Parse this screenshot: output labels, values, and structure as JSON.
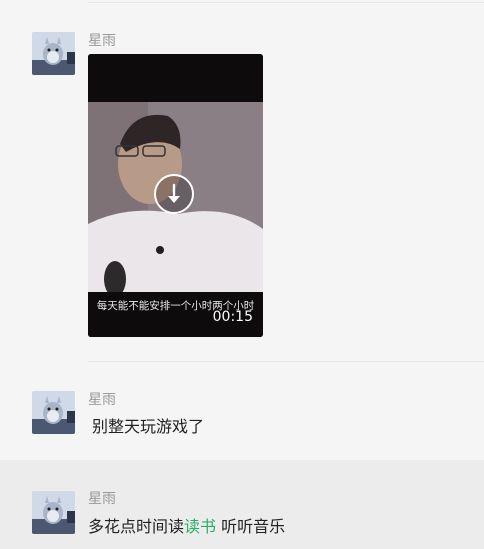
{
  "messages": [
    {
      "sender": "星雨",
      "type": "video",
      "subtitle": "每天能不能安排一个小时两个小时",
      "duration": "00:15"
    },
    {
      "sender": "星雨",
      "type": "text",
      "text": "别整天玩游戏了"
    },
    {
      "sender": "星雨",
      "type": "text",
      "text_before": "多花点时间读",
      "highlight": "读书",
      "text_after": " 听听音乐"
    }
  ],
  "colors": {
    "highlight_word": "#2aae67",
    "sender_name": "#999999",
    "background": "#f5f5f5",
    "highlight_row": "#ececec"
  },
  "icons": {
    "download": "download-arrow-icon",
    "avatar": "totoro-avatar"
  }
}
